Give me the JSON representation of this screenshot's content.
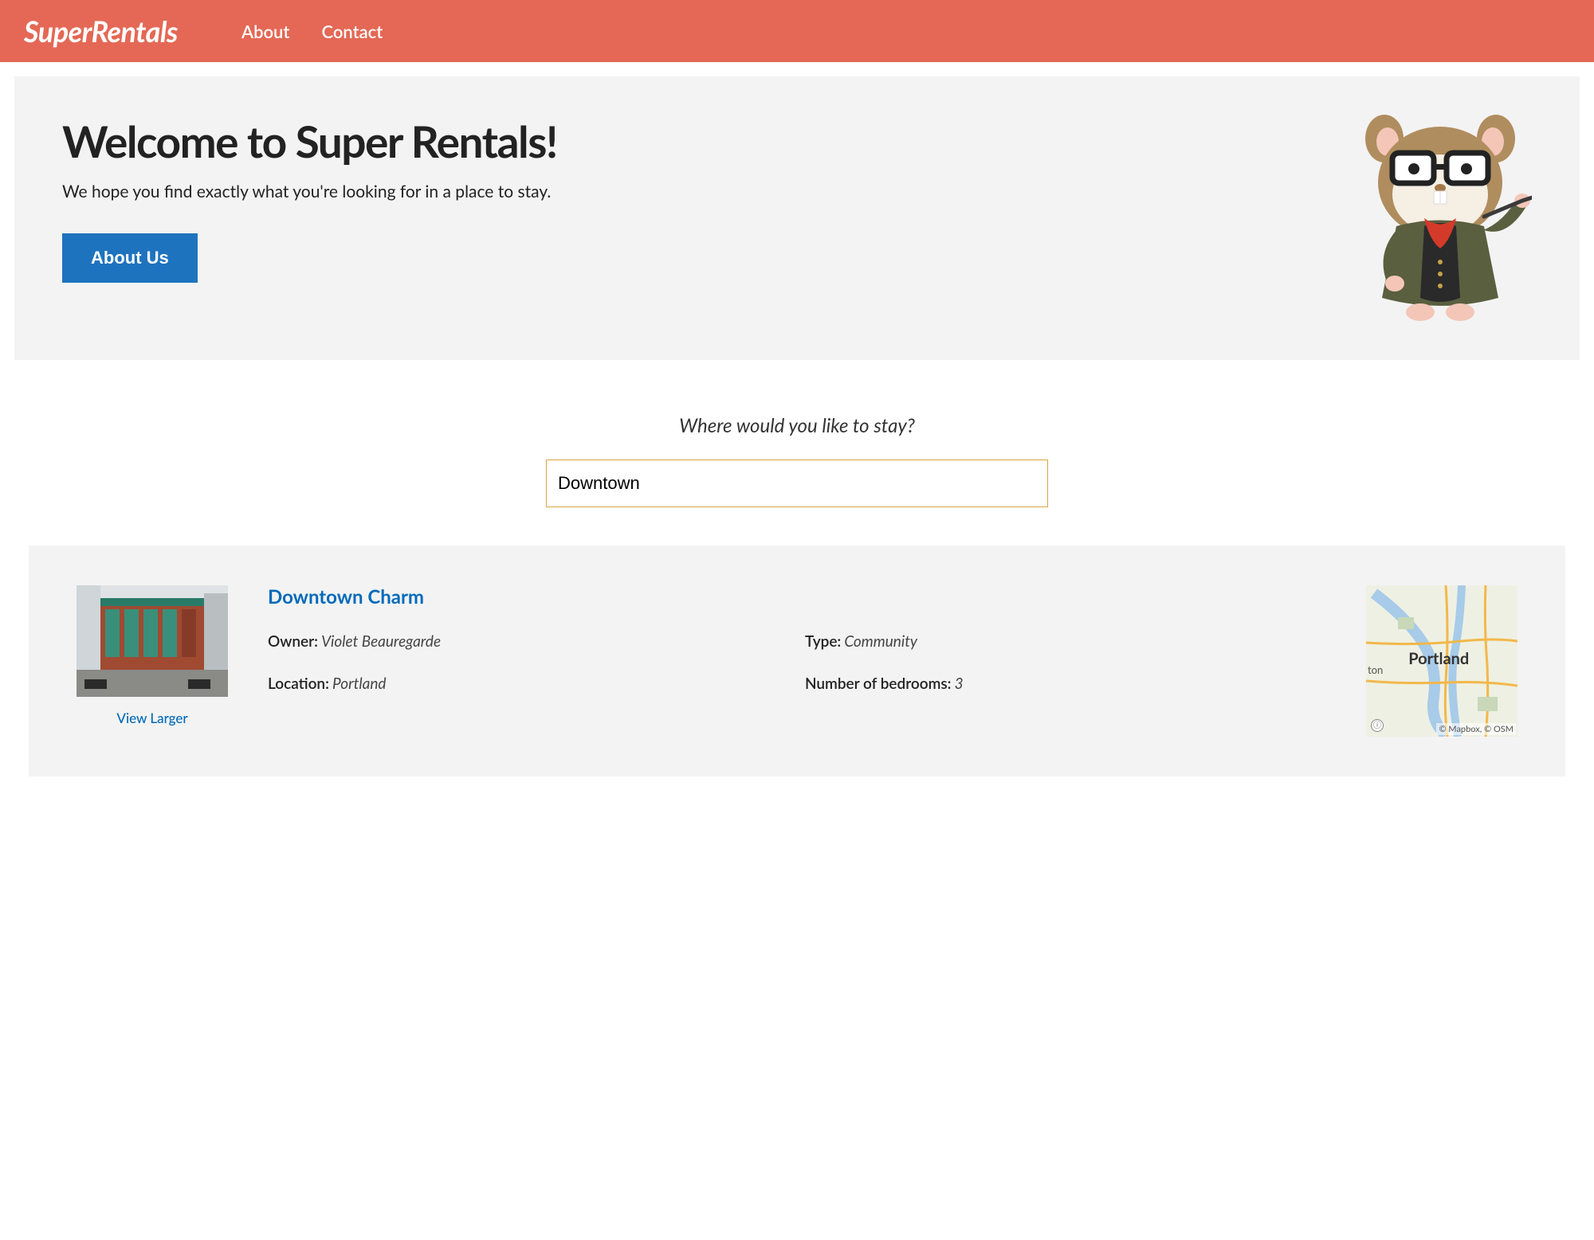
{
  "nav": {
    "brand": "SuperRentals",
    "links": [
      "About",
      "Contact"
    ]
  },
  "hero": {
    "title": "Welcome to Super Rentals!",
    "subtitle": "We hope you find exactly what you're looking for in a place to stay.",
    "button_label": "About Us"
  },
  "filter": {
    "prompt": "Where would you like to stay?",
    "value": "Downtown"
  },
  "listing": {
    "title": "Downtown Charm",
    "view_larger_label": "View Larger",
    "fields": {
      "owner_label": "Owner:",
      "owner_value": "Violet Beauregarde",
      "type_label": "Type:",
      "type_value": "Community",
      "location_label": "Location:",
      "location_value": "Portland",
      "bedrooms_label": "Number of bedrooms:",
      "bedrooms_value": "3"
    },
    "map": {
      "city_label": "Portland",
      "minor_label": "ton",
      "attribution": "© Mapbox, © OSM"
    }
  }
}
